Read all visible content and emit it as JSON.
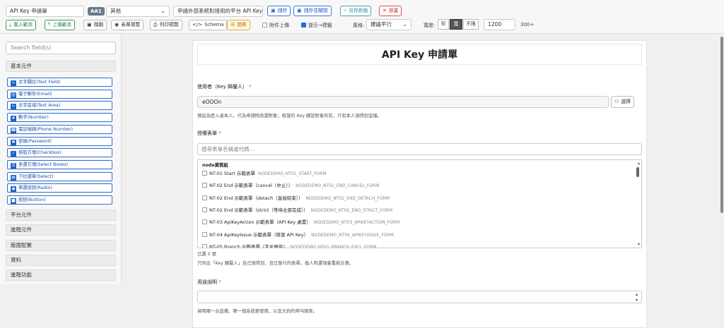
{
  "toolbar": {
    "form_name": "API Key 申請單",
    "badge": "AA1",
    "category": "其他",
    "description": "申請外部系統對接用的平台 API Key",
    "save": "儲存",
    "save_close": "儲存並關閉",
    "save_as": "另存新版",
    "discard": "放棄",
    "import_template": "載入範本",
    "upload_template": "上傳範本",
    "screenshot": "擷圖",
    "form_preview": "表單預覽",
    "print_preview": "列印預覽",
    "schema": "Schema",
    "variables": "變數",
    "attach_upload": "附件上傳",
    "hint_to_label": "提示→標籤",
    "layout_label": "風格:",
    "layout_value": "建議平行",
    "width_label": "寬度:",
    "width_opts": [
      "窄",
      "寬",
      "不限"
    ],
    "width_value": "1200",
    "width_suffix": "300+"
  },
  "sidebar": {
    "search_placeholder": "Search field(s)",
    "groups": [
      "基本元件",
      "平台元件",
      "進階元件",
      "版面配置",
      "資料",
      "進階功能"
    ],
    "items": [
      {
        "icon": "≻",
        "label": "文字欄位(Text Field)"
      },
      {
        "icon": "@",
        "label": "電子郵件(Email)"
      },
      {
        "icon": "≻",
        "label": "文字區域(Text Area)"
      },
      {
        "icon": "#",
        "label": "數字(Number)"
      },
      {
        "icon": "☎",
        "label": "電話號碼(Phone Number)"
      },
      {
        "icon": "✱",
        "label": "密碼(Password)"
      },
      {
        "icon": "✓",
        "label": "核取方塊(Checkbox)"
      },
      {
        "icon": "☰",
        "label": "多選方塊(Select Boxes)"
      },
      {
        "icon": "▤",
        "label": "下拉選單(Select)"
      },
      {
        "icon": "◉",
        "label": "單選按鈕(Radio)"
      },
      {
        "icon": "■",
        "label": "按鈕(Button)"
      }
    ]
  },
  "form": {
    "title": "API Key 申請單",
    "user_label": "使用者（Key 歸屬人）",
    "user_value": "eOOOn",
    "pick_button": "選擇",
    "user_help": "預設為登入者本人。代為申請時改選對象；核發的 Key 歸該對象所有，只有本人領得到金鑰。",
    "auth_label": "授權表單",
    "auth_search_placeholder": "搜尋表單名稱或代碼...",
    "list_header": "node資質組",
    "list": [
      {
        "name": "NT-01 Start 示範表單",
        "code": "NODEDEMO_NT01_START_FORM"
      },
      {
        "name": "NT-02 End 示範表單（cancel（中止））",
        "code": "NODEDEMO_NT02_END_CANCEL_FORM"
      },
      {
        "name": "NT-02 End 示範表單（detach（直接結束））",
        "code": "NODEDEMO_NT02_END_DETACH_FORM"
      },
      {
        "name": "NT-02 End 示範表單（strict（等待全部完成））",
        "code": "NODEDEMO_NT02_END_STRICT_FORM"
      },
      {
        "name": "NT-03 ApiKeyAction 示範表單（API Key 處置）",
        "code": "NODEDEMO_NT03_APIKEYACTION_FORM"
      },
      {
        "name": "NT-04 ApiKeyIssue 示範表單（核發 API Key）",
        "code": "NODEDEMO_NT04_APIKEYISSUE_FORM"
      },
      {
        "name": "NT-05 Branch 示範表單（互斥條件）",
        "code": "NODEDEMO_NT05_BRANCH_EXCL_FORM"
      }
    ],
    "selected_count": "已選 0 張",
    "auth_help": "只列出「Key 歸屬人」自己填得到、且已發行的表單。換人時選項會重新計算。",
    "purpose_label": "用途說明",
    "purpose_help": "寫明哪一台設備、哪一個系統要使用，以及大約的呼叫頻率。"
  }
}
